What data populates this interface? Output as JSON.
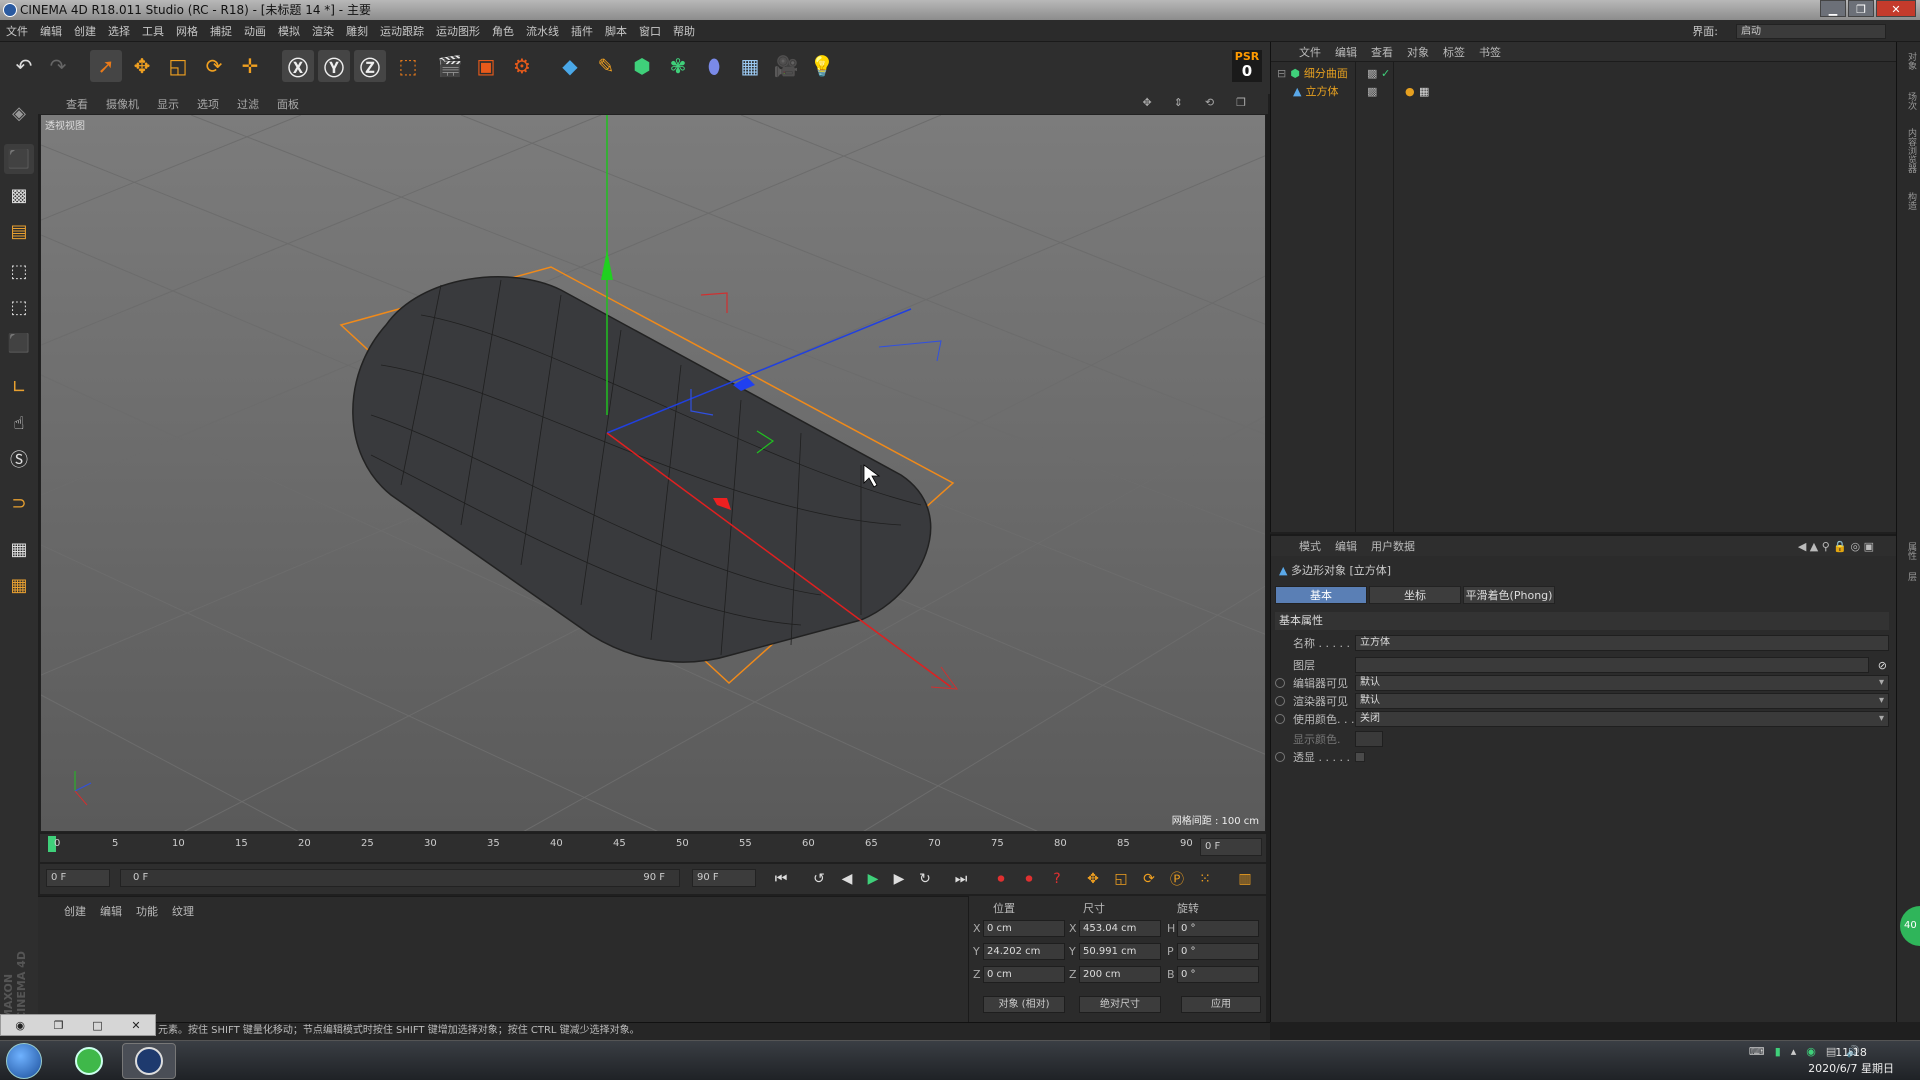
{
  "window": {
    "title": "CINEMA 4D R18.011 Studio (RC - R18) - [未标题 14 *] - 主要"
  },
  "menubar": {
    "items": [
      "文件",
      "编辑",
      "创建",
      "选择",
      "工具",
      "网格",
      "捕捉",
      "动画",
      "模拟",
      "渲染",
      "雕刻",
      "运动跟踪",
      "运动图形",
      "角色",
      "流水线",
      "插件",
      "脚本",
      "窗口",
      "帮助"
    ],
    "layout_label": "界面:",
    "layout_value": "启动"
  },
  "toolbar": {
    "psr_label": "PSR",
    "psr_value": "0"
  },
  "viewport": {
    "menu": [
      "查看",
      "摄像机",
      "显示",
      "选项",
      "过滤",
      "面板"
    ],
    "label": "透视视图",
    "grid_info": "网格间距 : 100 cm"
  },
  "timeline": {
    "ticks": [
      "0",
      "5",
      "10",
      "15",
      "20",
      "25",
      "30",
      "35",
      "40",
      "45",
      "50",
      "55",
      "60",
      "65",
      "70",
      "75",
      "80",
      "85",
      "90"
    ],
    "current_frame": "0 F"
  },
  "playback": {
    "start_frame": "0 F",
    "range_start": "0 F",
    "range_end": "90 F",
    "end_frame": "90 F"
  },
  "material_manager": {
    "menu": [
      "创建",
      "编辑",
      "功能",
      "纹理"
    ]
  },
  "coordinates": {
    "headers": [
      "位置",
      "尺寸",
      "旋转"
    ],
    "rows": [
      {
        "axis": "X",
        "pos": "0 cm",
        "size_axis": "X",
        "size": "453.04 cm",
        "rot_axis": "H",
        "rot": "0 °"
      },
      {
        "axis": "Y",
        "pos": "24.202 cm",
        "size_axis": "Y",
        "size": "50.991 cm",
        "rot_axis": "P",
        "rot": "0 °"
      },
      {
        "axis": "Z",
        "pos": "0 cm",
        "size_axis": "Z",
        "size": "200 cm",
        "rot_axis": "B",
        "rot": "0 °"
      }
    ],
    "mode": "对象 (相对)",
    "size_mode": "绝对尺寸",
    "apply": "应用"
  },
  "object_manager": {
    "menu": [
      "文件",
      "编辑",
      "查看",
      "对象",
      "标签",
      "书签"
    ],
    "objects": [
      {
        "name": "细分曲面",
        "color": "#e6a020"
      },
      {
        "name": "立方体",
        "color": "#e6a020"
      }
    ]
  },
  "attributes": {
    "menu": [
      "模式",
      "编辑",
      "用户数据"
    ],
    "title": "多边形对象 [立方体]",
    "tabs": [
      "基本",
      "坐标",
      "平滑着色(Phong)"
    ],
    "section": "基本属性",
    "fields": [
      {
        "label": "名称 . . . . .",
        "value": "立方体"
      },
      {
        "label": "图层",
        "value": ""
      },
      {
        "label": "编辑器可见",
        "value": "默认"
      },
      {
        "label": "渲染器可见",
        "value": "默认"
      },
      {
        "label": "使用颜色. . .",
        "value": "关闭"
      },
      {
        "label": "显示颜色.",
        "value": ""
      },
      {
        "label": "透显 . . . . .",
        "value": ""
      }
    ]
  },
  "statusbar": {
    "text": "元素。按住 SHIFT 键量化移动；节点编辑模式时按住 SHIFT 键增加选择对象；按住 CTRL 键减少选择对象。"
  },
  "badge": {
    "value": "40"
  },
  "taskbar": {
    "time": "11:18",
    "date": "2020/6/7 星期日"
  },
  "colors": {
    "accent_orange": "#ff8c1a",
    "selection_blue": "#5a7fb5",
    "axis_x": "#e02020",
    "axis_y": "#20c020",
    "axis_z": "#2040e0"
  }
}
